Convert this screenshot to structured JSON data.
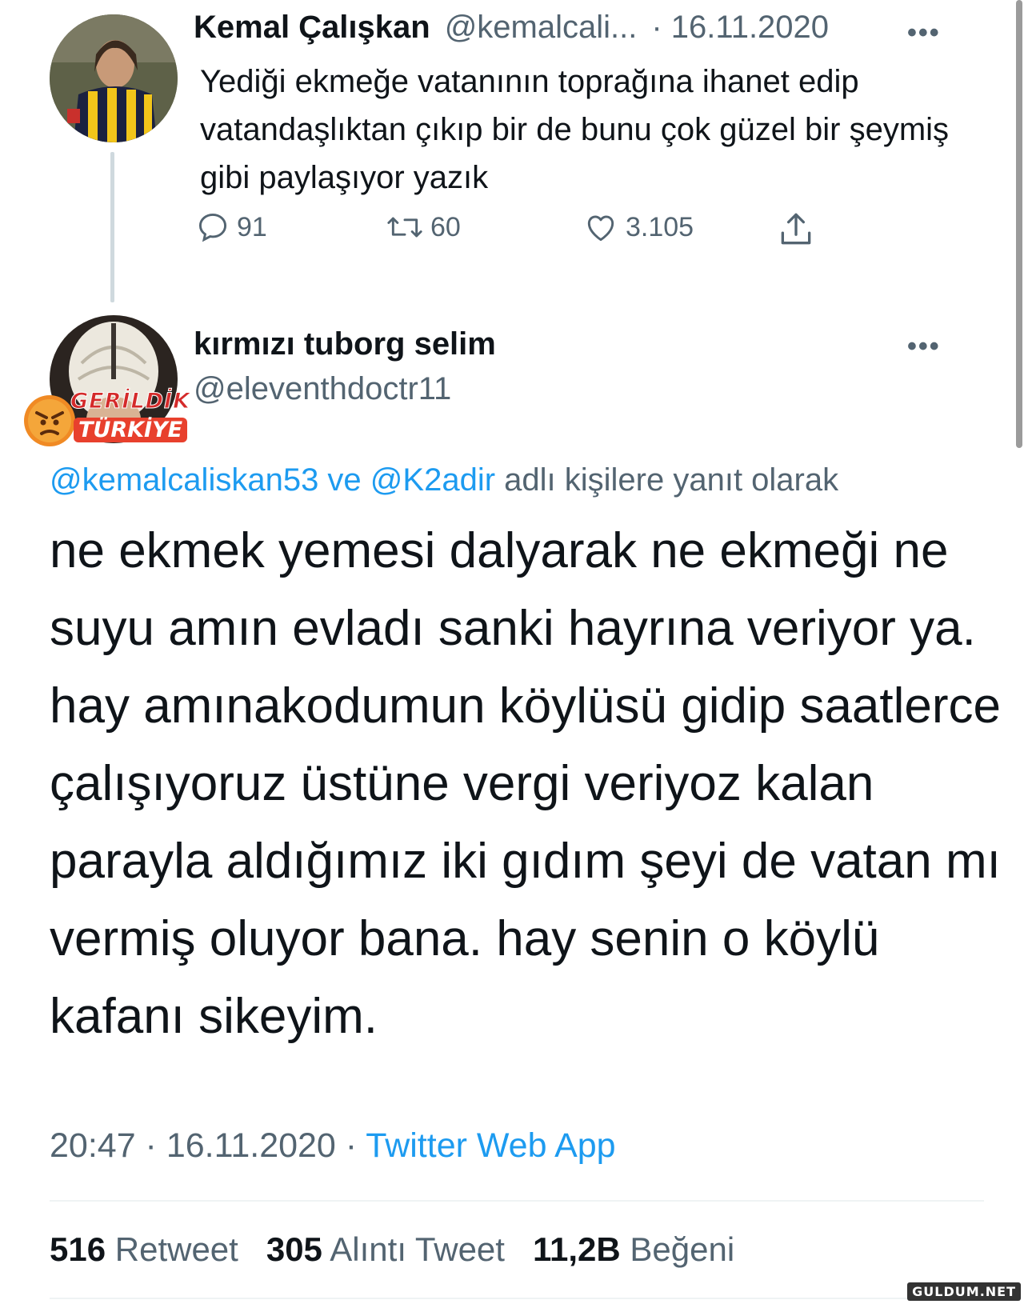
{
  "tweet1": {
    "name": "Kemal Çalışkan",
    "handle": "@kemalcali...",
    "date": "· 16.11.2020",
    "more_label": "•••",
    "text": "Yediği ekmeğe vatanının toprağına ihanet edip vatandaşlıktan çıkıp bir de bunu çok güzel bir şeymiş gibi paylaşıyor yazık",
    "actions": {
      "replies": "91",
      "retweets": "60",
      "likes": "3.105"
    },
    "avatar_colors": {
      "stripe_yellow": "#f2c51a",
      "stripe_dark": "#1b2140"
    }
  },
  "tweet2": {
    "name": "kırmızı tuborg selim",
    "handle": "@eleventhdoctr11",
    "more_label": "•••",
    "reply_prefix_1": "@kemalcaliskan53",
    "reply_joiner": " ve ",
    "reply_prefix_2": "@K2adir",
    "reply_suffix": " adlı kişilere yanıt olarak",
    "text": "ne ekmek yemesi dalyarak ne ekmeği ne suyu amın evladı sanki hayrına veriyor ya. hay amınakodumun köylüsü gidip saatlerce çalışıyoruz üstüne vergi veriyoz kalan parayla aldığımız iki gıdım şeyi de vatan mı vermiş oluyor bana. hay senin o köylü kafanı sikeyim.",
    "time": "20:47",
    "date": "16.11.2020",
    "separator": " · ",
    "source": "Twitter Web App",
    "stats": {
      "retweet_count": "516",
      "retweet_label": "Retweet",
      "quote_count": "305",
      "quote_label": "Alıntı Tweet",
      "like_count": "11,2B",
      "like_label": "Beğeni"
    }
  },
  "overlay_badge": {
    "line1": "GERİLDİK",
    "line2": "TÜRKİYE"
  },
  "watermark": "GULDUM.NET",
  "colors": {
    "link": "#1d9bf0",
    "secondary": "#536471",
    "text": "#0f1419"
  }
}
